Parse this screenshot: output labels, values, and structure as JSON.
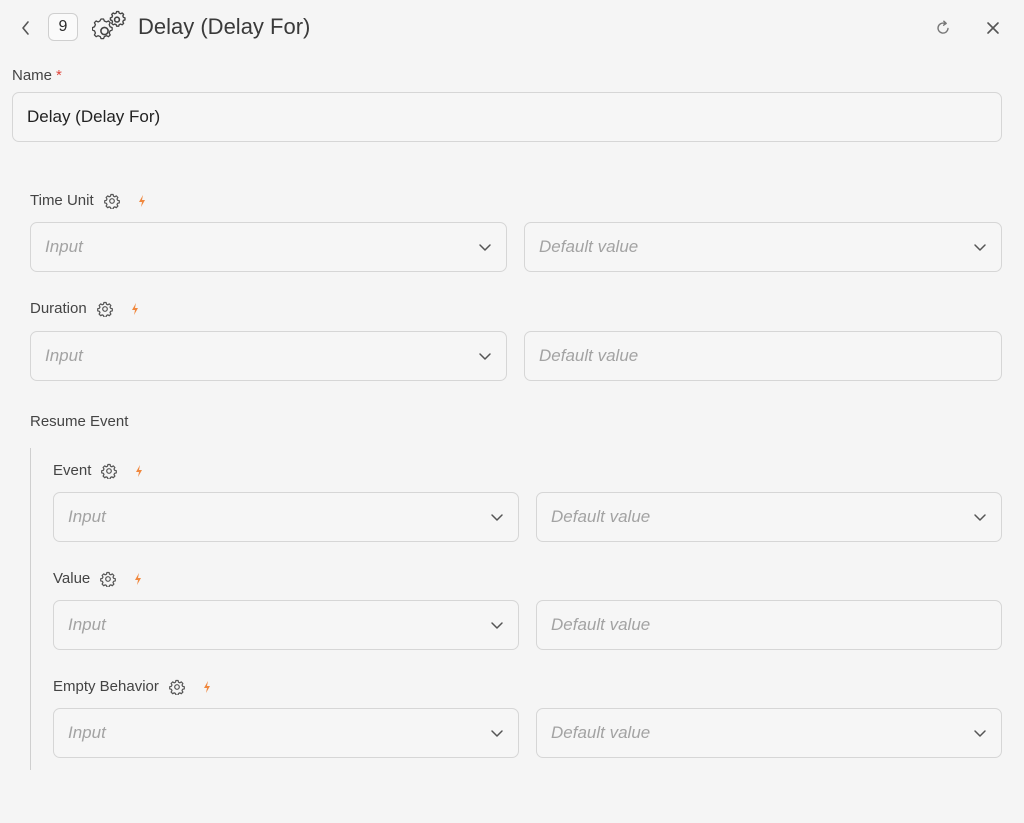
{
  "header": {
    "step_number": "9",
    "title": "Delay (Delay For)",
    "icons": {
      "back": "chevron-left-icon",
      "node": "gears-icon",
      "reload": "reload-icon",
      "close": "close-icon"
    }
  },
  "name_field": {
    "label": "Name",
    "required_mark": "*",
    "value": "Delay (Delay For)"
  },
  "fields": {
    "time_unit": {
      "label": "Time Unit",
      "input_placeholder": "Input",
      "default_placeholder": "Default value",
      "default_is_dropdown": true
    },
    "duration": {
      "label": "Duration",
      "input_placeholder": "Input",
      "default_placeholder": "Default value",
      "default_is_dropdown": false
    }
  },
  "resume_event": {
    "label": "Resume Event",
    "fields": {
      "event": {
        "label": "Event",
        "input_placeholder": "Input",
        "default_placeholder": "Default value",
        "default_is_dropdown": true
      },
      "value": {
        "label": "Value",
        "input_placeholder": "Input",
        "default_placeholder": "Default value",
        "default_is_dropdown": false
      },
      "empty_behavior": {
        "label": "Empty Behavior",
        "input_placeholder": "Input",
        "default_placeholder": "Default value",
        "default_is_dropdown": true
      }
    }
  },
  "colors": {
    "accent_bolt": "#f0883e",
    "required": "#e0453b",
    "placeholder": "#a3a3a3",
    "border": "#d6d6d6",
    "background": "#f5f5f5"
  }
}
